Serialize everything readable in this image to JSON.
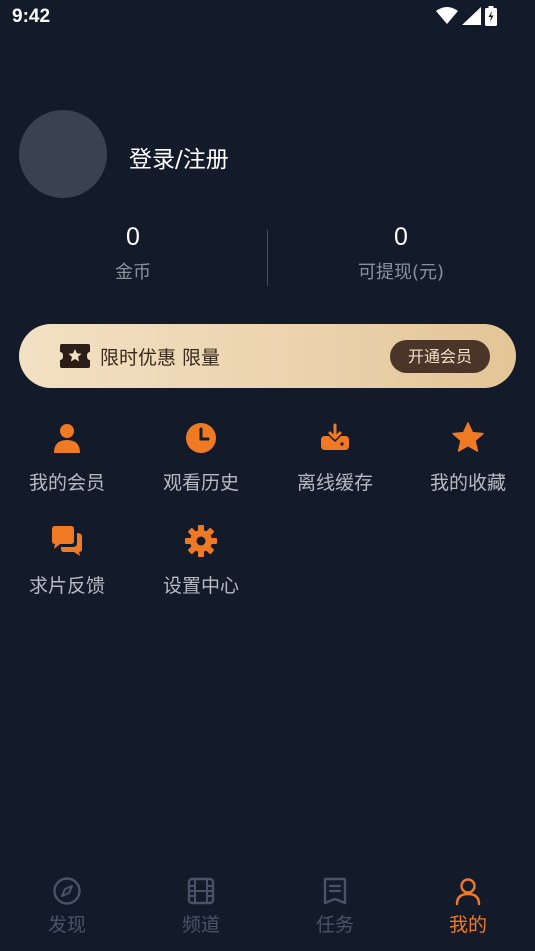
{
  "status_bar": {
    "time": "9:42"
  },
  "profile": {
    "login_text": "登录/注册"
  },
  "stats": [
    {
      "value": "0",
      "label": "金币"
    },
    {
      "value": "0",
      "label": "可提现(元)"
    }
  ],
  "vip_banner": {
    "text": "限时优惠 限量",
    "button_label": "开通会员"
  },
  "menu": [
    {
      "label": "我的会员",
      "icon": "person-icon"
    },
    {
      "label": "观看历史",
      "icon": "clock-icon"
    },
    {
      "label": "离线缓存",
      "icon": "download-icon"
    },
    {
      "label": "我的收藏",
      "icon": "star-icon"
    },
    {
      "label": "求片反馈",
      "icon": "chat-icon"
    },
    {
      "label": "设置中心",
      "icon": "gear-icon"
    }
  ],
  "tabs": [
    {
      "label": "发现",
      "icon": "compass-icon",
      "active": false
    },
    {
      "label": "频道",
      "icon": "film-icon",
      "active": false
    },
    {
      "label": "任务",
      "icon": "task-icon",
      "active": false
    },
    {
      "label": "我的",
      "icon": "user-icon",
      "active": true
    }
  ],
  "colors": {
    "background": "#131a2a",
    "accent": "#f07a23",
    "vip_gold": "#ead2ac",
    "muted_text": "#8a909c"
  }
}
